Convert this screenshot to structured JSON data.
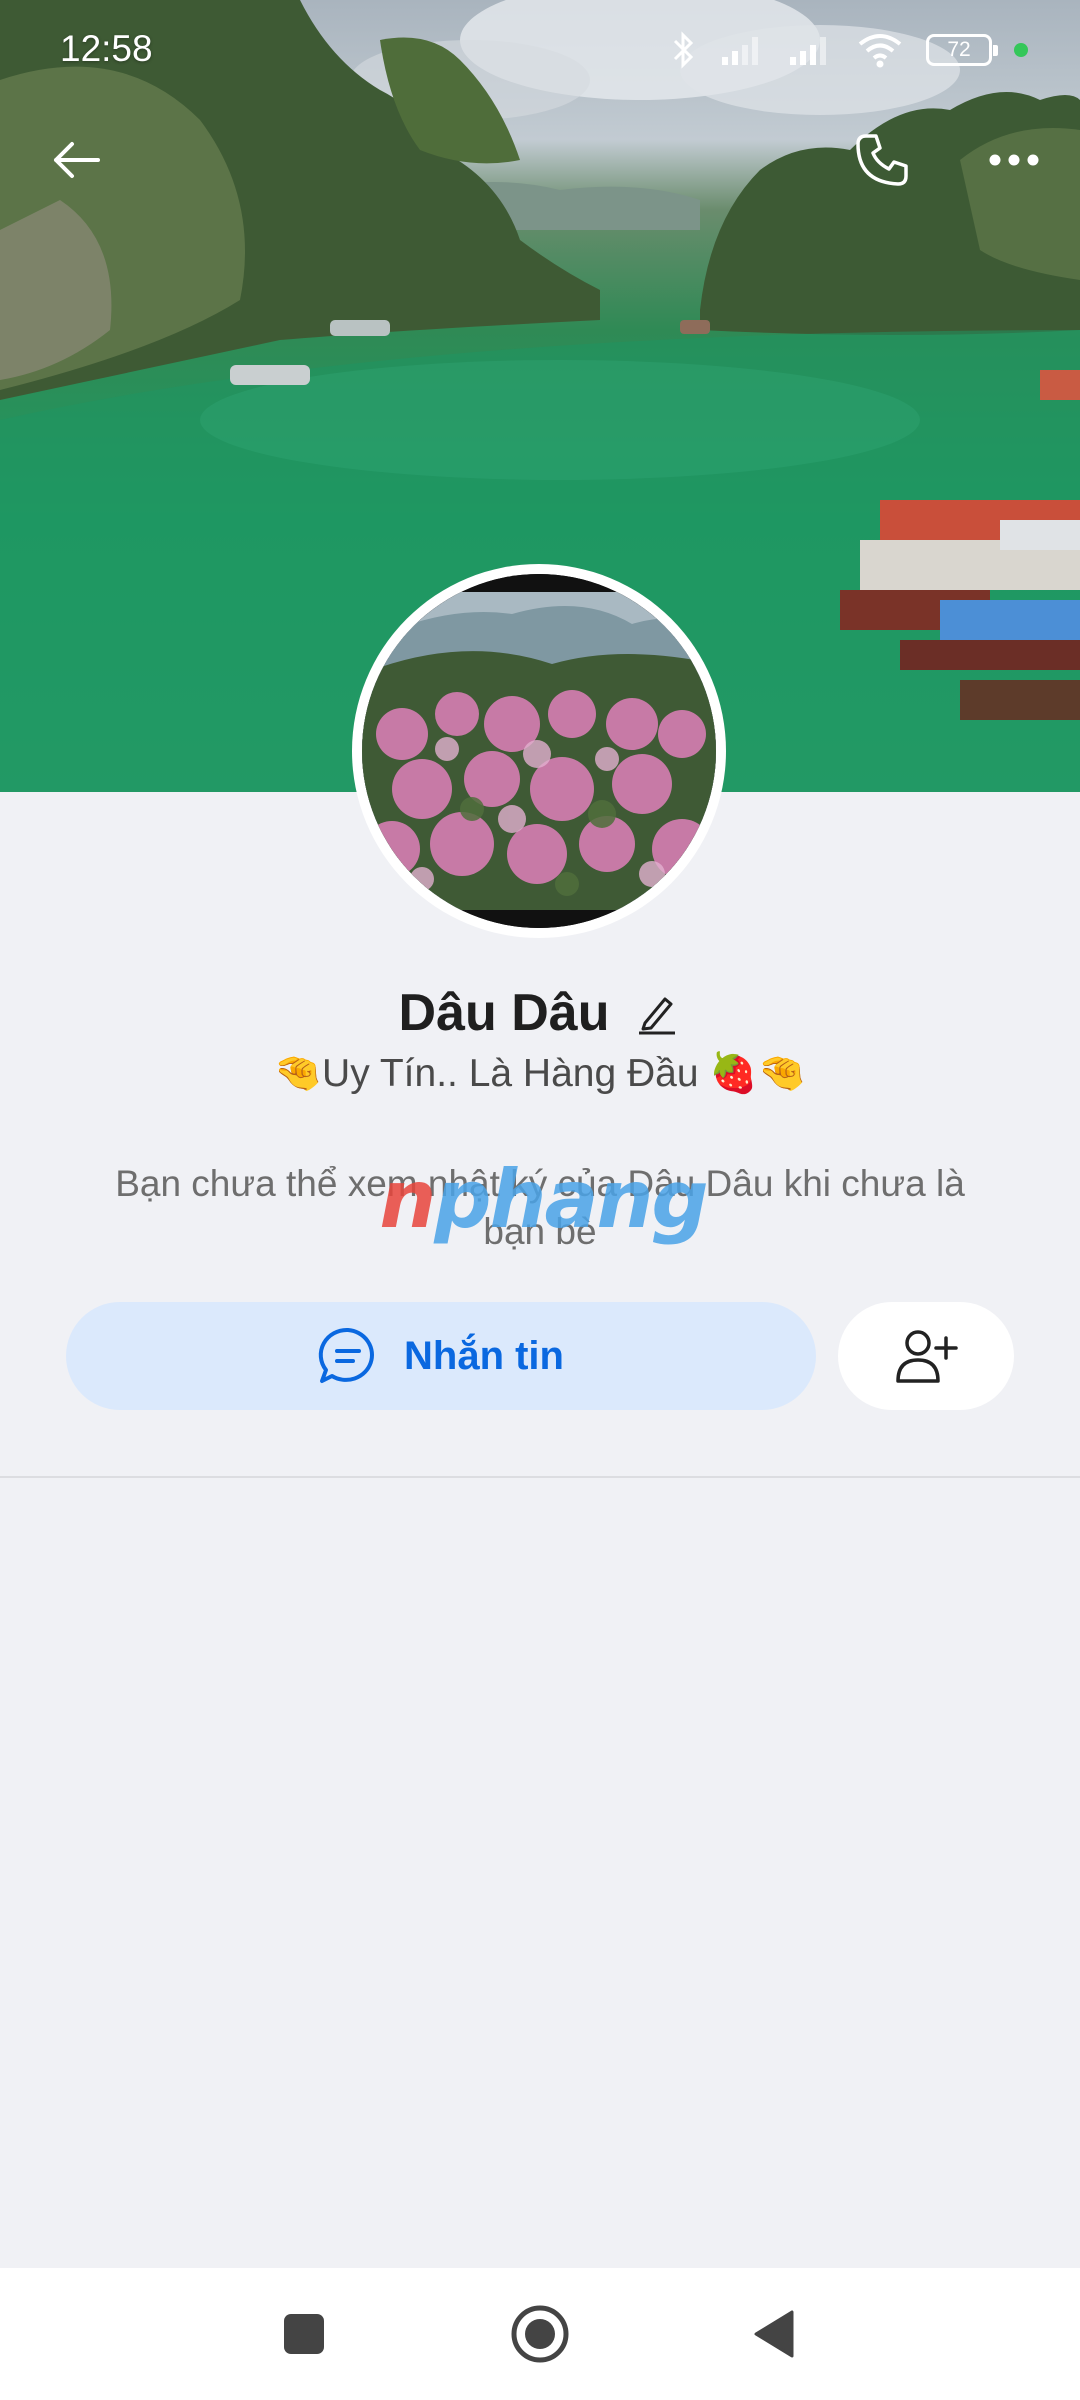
{
  "status_bar": {
    "time": "12:58",
    "battery_level": "72",
    "icons": [
      "bluetooth-icon",
      "signal-icon",
      "signal-icon",
      "wifi-icon",
      "battery-icon",
      "active-dot"
    ]
  },
  "header": {
    "back_icon": "arrow-left-icon",
    "call_icon": "phone-icon",
    "more_icon": "more-horizontal-icon"
  },
  "profile": {
    "name": "Dâu Dâu",
    "bio": "🤏Uy Tín.. Là Hàng Đầu 🍓🤏",
    "notice": "Bạn chưa thể xem nhật ký của Dâu Dâu khi chưa là bạn bè",
    "edit_icon": "pencil-icon"
  },
  "watermark": {
    "first_letter": "n",
    "rest": "phang"
  },
  "actions": {
    "message_label": "Nhắn tin",
    "message_icon": "chat-bubble-icon",
    "add_friend_icon": "user-plus-icon"
  },
  "system_nav": {
    "icons": [
      "recent-apps-icon",
      "home-icon",
      "back-icon"
    ]
  },
  "colors": {
    "accent": "#0a68e0",
    "message_button_bg": "#dbe9fc",
    "page_bg": "#f0f1f5"
  }
}
